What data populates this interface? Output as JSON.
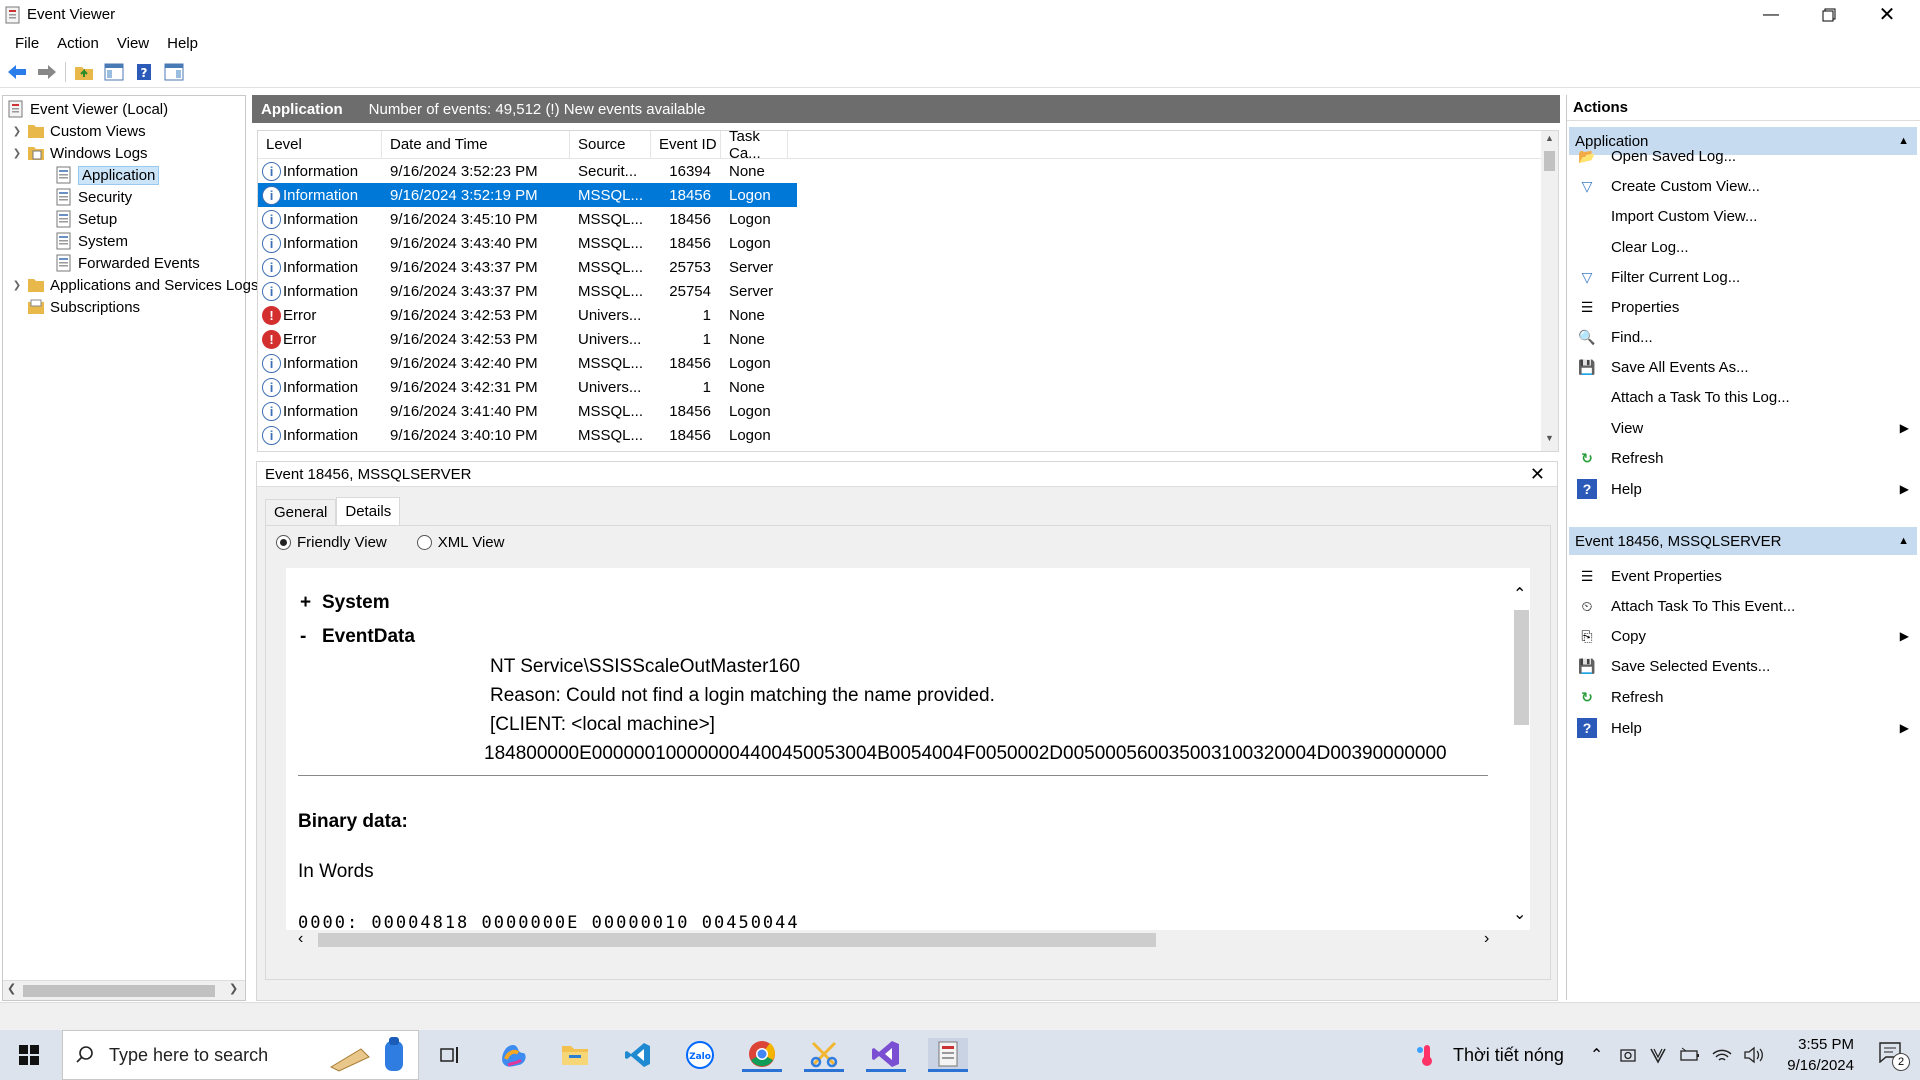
{
  "window": {
    "title": "Event Viewer"
  },
  "menu": [
    "File",
    "Action",
    "View",
    "Help"
  ],
  "tree": {
    "root": "Event Viewer (Local)",
    "custom_views": "Custom Views",
    "windows_logs": "Windows Logs",
    "application": "Application",
    "security": "Security",
    "setup": "Setup",
    "system": "System",
    "forwarded": "Forwarded Events",
    "app_services": "Applications and Services Logs",
    "subscriptions": "Subscriptions"
  },
  "log_header": {
    "name": "Application",
    "count_text": "Number of events: 49,512 (!) New events available"
  },
  "columns": [
    "Level",
    "Date and Time",
    "Source",
    "Event ID",
    "Task Ca..."
  ],
  "events": [
    {
      "level": "Information",
      "type": "info",
      "date": "9/16/2024 3:52:23 PM",
      "source": "Securit...",
      "id": "16394",
      "task": "None"
    },
    {
      "level": "Information",
      "type": "info",
      "date": "9/16/2024 3:52:19 PM",
      "source": "MSSQL...",
      "id": "18456",
      "task": "Logon"
    },
    {
      "level": "Information",
      "type": "info",
      "date": "9/16/2024 3:45:10 PM",
      "source": "MSSQL...",
      "id": "18456",
      "task": "Logon"
    },
    {
      "level": "Information",
      "type": "info",
      "date": "9/16/2024 3:43:40 PM",
      "source": "MSSQL...",
      "id": "18456",
      "task": "Logon"
    },
    {
      "level": "Information",
      "type": "info",
      "date": "9/16/2024 3:43:37 PM",
      "source": "MSSQL...",
      "id": "25753",
      "task": "Server"
    },
    {
      "level": "Information",
      "type": "info",
      "date": "9/16/2024 3:43:37 PM",
      "source": "MSSQL...",
      "id": "25754",
      "task": "Server"
    },
    {
      "level": "Error",
      "type": "err",
      "date": "9/16/2024 3:42:53 PM",
      "source": "Univers...",
      "id": "1",
      "task": "None"
    },
    {
      "level": "Error",
      "type": "err",
      "date": "9/16/2024 3:42:53 PM",
      "source": "Univers...",
      "id": "1",
      "task": "None"
    },
    {
      "level": "Information",
      "type": "info",
      "date": "9/16/2024 3:42:40 PM",
      "source": "MSSQL...",
      "id": "18456",
      "task": "Logon"
    },
    {
      "level": "Information",
      "type": "info",
      "date": "9/16/2024 3:42:31 PM",
      "source": "Univers...",
      "id": "1",
      "task": "None"
    },
    {
      "level": "Information",
      "type": "info",
      "date": "9/16/2024 3:41:40 PM",
      "source": "MSSQL...",
      "id": "18456",
      "task": "Logon"
    },
    {
      "level": "Information",
      "type": "info",
      "date": "9/16/2024 3:40:10 PM",
      "source": "MSSQL...",
      "id": "18456",
      "task": "Logon"
    }
  ],
  "selected_row": 1,
  "detail": {
    "title": "Event 18456, MSSQLSERVER",
    "tabs": [
      "General",
      "Details"
    ],
    "friendly": "Friendly View",
    "xml": "XML View",
    "system": "System",
    "eventdata": "EventData",
    "plus": "+",
    "minus": "-",
    "data_lines": [
      "NT Service\\SSISScaleOutMaster160",
      "Reason: Could not find a login matching the name provided.",
      "[CLIENT: <local machine>]",
      "184800000E000000100000004400450053004B0054004F0050002D005000560035003100320004D00390000000"
    ],
    "binary_label": "Binary data:",
    "words_label": "In Words",
    "binary_row": "0000:  00004818  0000000E  00000010  00450044"
  },
  "actions": {
    "header": "Actions",
    "section1": "Application",
    "items1": [
      "Open Saved Log...",
      "Create Custom View...",
      "Import Custom View...",
      "Clear Log...",
      "Filter Current Log...",
      "Properties",
      "Find...",
      "Save All Events As...",
      "Attach a Task To this Log...",
      "View",
      "Refresh",
      "Help"
    ],
    "section2": "Event 18456, MSSQLSERVER",
    "items2": [
      "Event Properties",
      "Attach Task To This Event...",
      "Copy",
      "Save Selected Events...",
      "Refresh",
      "Help"
    ]
  },
  "taskbar": {
    "search_placeholder": "Type here to search",
    "weather": "Thời tiết nóng",
    "time": "3:55 PM",
    "date": "9/16/2024",
    "notif_count": "2"
  },
  "colors": {
    "selection": "#0078d7",
    "section_bg": "#c6dbf0",
    "header_bg": "#6d6d6d",
    "error": "#d32f2f",
    "info": "#3f6fb5"
  }
}
